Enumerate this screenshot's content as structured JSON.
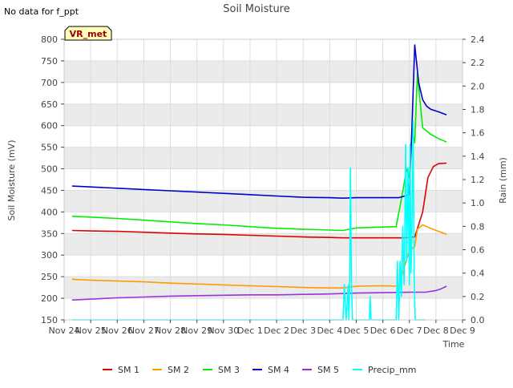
{
  "note": "No data for f_ppt",
  "badge": "VR_met",
  "chart_data": {
    "type": "line",
    "title": "Soil Moisture",
    "xlabel": "Time",
    "ylabel": "Soil Moisture (mV)",
    "y2label": "Rain (mm)",
    "xlim": [
      0,
      15
    ],
    "ylim": [
      150,
      800
    ],
    "y2lim": [
      0,
      2.4
    ],
    "xticks": [
      {
        "value": 0,
        "label": "Nov 24"
      },
      {
        "value": 1,
        "label": "Nov 25"
      },
      {
        "value": 2,
        "label": "Nov 26"
      },
      {
        "value": 3,
        "label": "Nov 27"
      },
      {
        "value": 4,
        "label": "Nov 28"
      },
      {
        "value": 5,
        "label": "Nov 29"
      },
      {
        "value": 6,
        "label": "Nov 30"
      },
      {
        "value": 7,
        "label": "Dec 1"
      },
      {
        "value": 8,
        "label": "Dec 2"
      },
      {
        "value": 9,
        "label": "Dec 3"
      },
      {
        "value": 10,
        "label": "Dec 4"
      },
      {
        "value": 11,
        "label": "Dec 5"
      },
      {
        "value": 12,
        "label": "Dec 6"
      },
      {
        "value": 13,
        "label": "Dec 7"
      },
      {
        "value": 14,
        "label": "Dec 8"
      },
      {
        "value": 15,
        "label": "Dec 9"
      }
    ],
    "yticks": [
      150,
      200,
      250,
      300,
      350,
      400,
      450,
      500,
      550,
      600,
      650,
      700,
      750,
      800
    ],
    "y2ticks": [
      0.0,
      0.2,
      0.4,
      0.6,
      0.8,
      1.0,
      1.2,
      1.4,
      1.6,
      1.8,
      2.0,
      2.2,
      2.4
    ],
    "grid": true,
    "legend_position": "bottom",
    "series": [
      {
        "name": "SM 1",
        "color": "#dd0000",
        "axis": "left",
        "x": [
          0.3,
          1,
          2,
          3,
          4,
          5,
          6,
          7,
          8,
          9,
          10,
          10.5,
          11,
          12,
          12.8,
          13.2,
          13.5,
          13.7,
          13.9,
          14.1,
          14.4
        ],
        "y": [
          357,
          356,
          355,
          353,
          351,
          349,
          348,
          346,
          344,
          342,
          341,
          340,
          340,
          340,
          340,
          342,
          400,
          480,
          505,
          512,
          513
        ]
      },
      {
        "name": "SM 2",
        "color": "#ff9900",
        "axis": "left",
        "x": [
          0.3,
          1,
          2,
          3,
          4,
          5,
          6,
          7,
          8,
          9,
          10,
          10.5,
          11,
          12,
          12.6,
          12.8,
          13.0,
          13.2,
          13.3,
          13.5,
          13.8,
          14.1,
          14.4
        ],
        "y": [
          244,
          242,
          240,
          238,
          235,
          233,
          231,
          229,
          227,
          225,
          224,
          224,
          228,
          229,
          228,
          270,
          310,
          320,
          360,
          370,
          362,
          355,
          348
        ]
      },
      {
        "name": "SM 3",
        "color": "#00ee00",
        "axis": "left",
        "x": [
          0.3,
          1,
          2,
          3,
          4,
          5,
          6,
          7,
          8,
          9,
          10,
          10.5,
          11,
          12,
          12.5,
          12.7,
          12.9,
          13.0,
          13.1,
          13.2,
          13.3,
          13.5,
          13.8,
          14.1,
          14.4
        ],
        "y": [
          390,
          388,
          385,
          381,
          377,
          373,
          370,
          366,
          362,
          360,
          358,
          357,
          363,
          365,
          366,
          430,
          500,
          480,
          590,
          560,
          720,
          595,
          580,
          570,
          562
        ]
      },
      {
        "name": "SM 4",
        "color": "#0000cc",
        "axis": "left",
        "x": [
          0.3,
          1,
          2,
          3,
          4,
          5,
          6,
          7,
          8,
          9,
          10,
          10.5,
          11,
          12,
          12.6,
          13.0,
          13.1,
          13.2,
          13.35,
          13.5,
          13.65,
          13.8,
          14.1,
          14.4
        ],
        "y": [
          460,
          458,
          455,
          452,
          449,
          446,
          443,
          440,
          437,
          434,
          433,
          432,
          433,
          433,
          433,
          440,
          600,
          787,
          700,
          660,
          645,
          638,
          632,
          625
        ]
      },
      {
        "name": "SM 5",
        "color": "#9933dd",
        "axis": "left",
        "x": [
          0.3,
          1,
          2,
          3,
          4,
          5,
          6,
          7,
          8,
          9,
          10,
          11,
          12,
          13,
          13.6,
          14.0,
          14.2,
          14.4
        ],
        "y": [
          196,
          198,
          201,
          203,
          205,
          206,
          207,
          208,
          208,
          209,
          210,
          212,
          213,
          214,
          214,
          218,
          222,
          228
        ]
      },
      {
        "name": "Precip_mm",
        "color": "#00ffff",
        "axis": "right",
        "x": [
          0.3,
          10.5,
          10.55,
          10.62,
          10.7,
          10.72,
          10.75,
          10.78,
          10.82,
          10.86,
          10.9,
          11.5,
          11.52,
          11.56,
          11.6,
          12.5,
          12.55,
          12.6,
          12.65,
          12.7,
          12.75,
          12.8,
          12.82,
          12.86,
          12.9,
          12.95,
          13.0,
          13.03,
          13.06,
          13.1,
          13.14,
          13.18,
          13.22,
          13.26,
          13.3,
          13.6
        ],
        "y": [
          0,
          0,
          0.3,
          0,
          0.3,
          0,
          0.3,
          1.3,
          0.3,
          0,
          0,
          0,
          0.2,
          0,
          0,
          0,
          0.5,
          0,
          0.5,
          0.2,
          0.8,
          0.3,
          0.6,
          1.5,
          0.5,
          1.3,
          0.3,
          1.5,
          0.4,
          0.8,
          1.7,
          0.4,
          0,
          0,
          0,
          0
        ]
      }
    ]
  }
}
